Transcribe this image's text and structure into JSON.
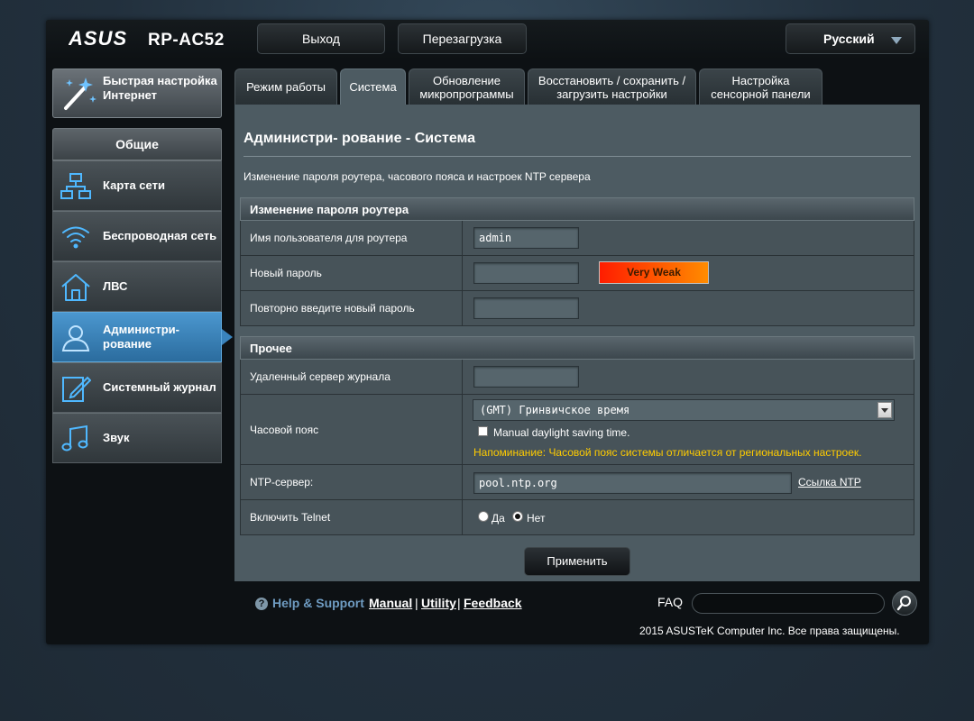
{
  "header": {
    "brand": "ASUS",
    "model": "RP-AC52",
    "logout_label": "Выход",
    "reboot_label": "Перезагрузка",
    "language": "Русский"
  },
  "sidebar": {
    "quick_setup": "Быстрая настройка Интернет",
    "section_title": "Общие",
    "items": [
      {
        "label": "Карта сети",
        "icon": "network-map-icon"
      },
      {
        "label": "Беспроводная сеть",
        "icon": "wireless-icon"
      },
      {
        "label": "ЛВС",
        "icon": "lan-home-icon"
      },
      {
        "label": "Администри- рование",
        "icon": "admin-user-icon",
        "active": true
      },
      {
        "label": "Системный журнал",
        "icon": "system-log-icon"
      },
      {
        "label": "Звук",
        "icon": "sound-icon"
      }
    ]
  },
  "tabs": [
    {
      "label": "Режим работы"
    },
    {
      "label": "Система",
      "active": true
    },
    {
      "label": "Обновление микропрограммы"
    },
    {
      "label": "Восстановить / сохранить / загрузить настройки"
    },
    {
      "label": "Настройка сенсорной панели"
    }
  ],
  "main": {
    "title": "Администри- рование - Система",
    "description": "Изменение пароля роутера, часового пояса и настроек NTP сервера",
    "password_section": {
      "title": "Изменение пароля роутера",
      "username_label": "Имя пользователя для роутера",
      "username_value": "admin",
      "new_password_label": "Новый пароль",
      "new_password_value": "",
      "strength": "Very Weak",
      "repeat_password_label": "Повторно введите новый пароль",
      "repeat_password_value": ""
    },
    "misc_section": {
      "title": "Прочее",
      "log_server_label": "Удаленный сервер журнала",
      "log_server_value": "",
      "timezone_label": "Часовой пояс",
      "timezone_value": "(GMT) Гринвичское время",
      "dst_label": "Manual daylight saving time.",
      "timezone_warning": "Напоминание: Часовой пояс системы отличается от региональных настроек.",
      "ntp_label": "NTP-сервер:",
      "ntp_value": "pool.ntp.org",
      "ntp_link": "Ссылка NTP",
      "telnet_label": "Включить Telnet",
      "telnet_yes": "Да",
      "telnet_no": "Нет",
      "telnet_selected": "no"
    },
    "apply_label": "Применить"
  },
  "footer": {
    "help_label": "Help & Support",
    "links": [
      "Manual",
      "Utility",
      "Feedback"
    ],
    "separator": "|",
    "faq_label": "FAQ",
    "search_value": "",
    "copyright": "2015 ASUSTeK Computer Inc. Все права защищены."
  },
  "colors": {
    "accent": "#3a84bd",
    "warning": "#ffcc00",
    "help": "#6f9cc2"
  }
}
